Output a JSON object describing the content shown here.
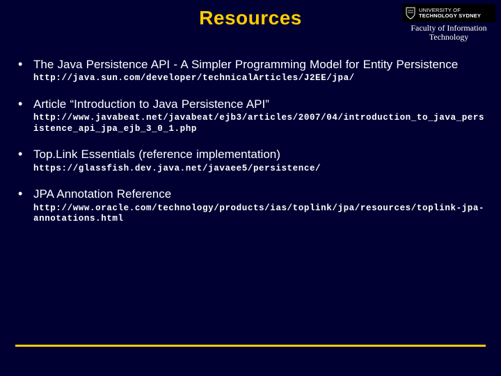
{
  "header": {
    "title": "Resources",
    "logo_line1": "UNIVERSITY OF",
    "logo_line2": "TECHNOLOGY SYDNEY",
    "faculty_line1": "Faculty of Information",
    "faculty_line2": "Technology"
  },
  "items": [
    {
      "title": "The Java Persistence API - A Simpler Programming Model for Entity Persistence",
      "url": "http://java.sun.com/developer/technicalArticles/J2EE/jpa/"
    },
    {
      "title": "Article “Introduction to Java Persistence API”",
      "url": "http://www.javabeat.net/javabeat/ejb3/articles/2007/04/introduction_to_java_persistence_api_jpa_ejb_3_0_1.php"
    },
    {
      "title": "Top.Link Essentials (reference implementation)",
      "url": "https://glassfish.dev.java.net/javaee5/persistence/"
    },
    {
      "title": "JPA Annotation Reference",
      "url": "http://www.oracle.com/technology/products/ias/toplink/jpa/resources/toplink-jpa-annotations.html"
    }
  ]
}
